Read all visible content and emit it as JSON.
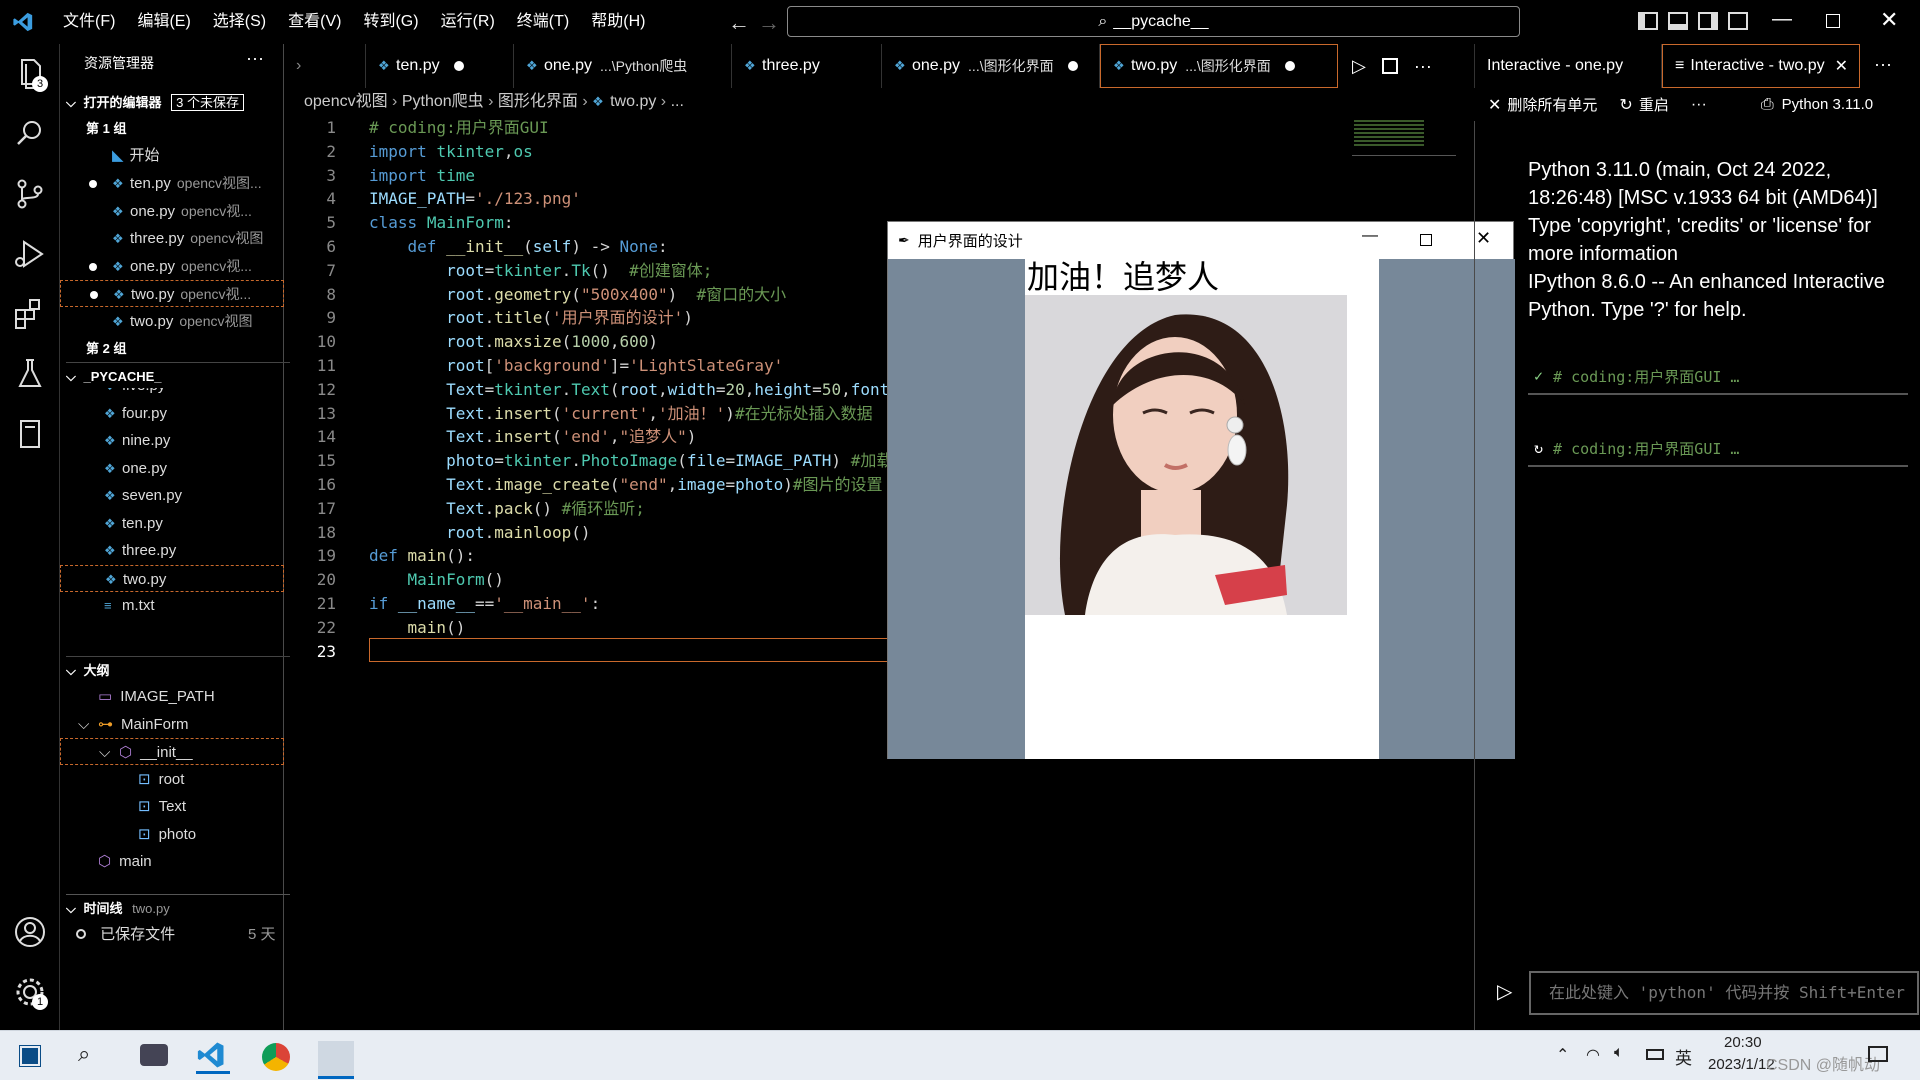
{
  "menu": [
    "文件(F)",
    "编辑(E)",
    "选择(S)",
    "查看(V)",
    "转到(G)",
    "运行(R)",
    "终端(T)",
    "帮助(H)"
  ],
  "search": {
    "text": "__pycache__"
  },
  "activity_badges": {
    "explorer": "3",
    "settings": "1"
  },
  "sidebar": {
    "title": "资源管理器",
    "open_editors": {
      "label": "打开的编辑器",
      "badge": "3 个未保存"
    },
    "group1": "第 1 组",
    "start": "开始",
    "files_group1": [
      {
        "name": "ten.py",
        "path": "opencv视图...",
        "dirty": true
      },
      {
        "name": "one.py",
        "path": "opencv视...",
        "dirty": false
      },
      {
        "name": "three.py",
        "path": "opencv视图",
        "dirty": false
      },
      {
        "name": "one.py",
        "path": "opencv视...",
        "dirty": true
      },
      {
        "name": "two.py",
        "path": "opencv视...",
        "dirty": true
      },
      {
        "name": "two.py",
        "path": "opencv视图",
        "dirty": false
      }
    ],
    "group2": "第 2 组",
    "pycache": "_PYCACHE_",
    "pycache_files": [
      "five.py",
      "four.py",
      "nine.py",
      "one.py",
      "seven.py",
      "ten.py",
      "three.py",
      "two.py",
      "m.txt"
    ],
    "outline": {
      "label": "大纲",
      "items": [
        {
          "name": "IMAGE_PATH",
          "depth": 0
        },
        {
          "name": "MainForm",
          "depth": 0
        },
        {
          "name": "__init__",
          "depth": 1
        },
        {
          "name": "root",
          "depth": 2
        },
        {
          "name": "Text",
          "depth": 2
        },
        {
          "name": "photo",
          "depth": 2
        },
        {
          "name": "main",
          "depth": 0
        }
      ]
    },
    "timeline": {
      "label": "时间线",
      "file": "two.py",
      "entry": "已保存文件",
      "age": "5 天"
    }
  },
  "tabs": [
    {
      "name": "ten.py",
      "desc": "",
      "dirty": true
    },
    {
      "name": "one.py",
      "desc": "...\\Python爬虫",
      "dirty": false
    },
    {
      "name": "three.py",
      "desc": "",
      "dirty": false
    },
    {
      "name": "one.py",
      "desc": "...\\图形化界面",
      "dirty": true
    },
    {
      "name": "two.py",
      "desc": "...\\图形化界面",
      "dirty": true,
      "active": true
    }
  ],
  "breadcrumb": [
    "opencv视图",
    "Python爬虫",
    "图形化界面",
    "two.py",
    "..."
  ],
  "code_lines": [
    "1",
    "2",
    "3",
    "4",
    "5",
    "6",
    "7",
    "8",
    "9",
    "10",
    "11",
    "12",
    "13",
    "14",
    "15",
    "16",
    "17",
    "18",
    "19",
    "20",
    "21",
    "22",
    "23"
  ],
  "tk_window": {
    "title": "用户界面的设计",
    "heading": "加油！追梦人"
  },
  "right_tabs": [
    "Interactive - one.py",
    "Interactive - two.py"
  ],
  "right_toolbar": {
    "clear": "删除所有单元",
    "restart": "重启",
    "kernel": "Python 3.11.0"
  },
  "interactive_output": {
    "banner": [
      "Python 3.11.0 (main, Oct 24 2022, 18:26:48) [MSC v.1933 64 bit (AMD64)]",
      "Type 'copyright', 'credits' or 'license' for more information",
      "IPython 8.6.0 -- An enhanced Interactive Python. Type '?' for help."
    ],
    "cells": [
      "# coding:用户界面GUI …",
      "# coding:用户界面GUI …"
    ]
  },
  "input_placeholder": "在此处键入 'python' 代码并按 Shift+Enter",
  "taskbar": {
    "time": "20:30",
    "date": "2023/1/12",
    "ime": "英",
    "watermark": "CSDN @随帆动"
  },
  "colors": {
    "accent_border": "#c9692c",
    "tk_background": "#778899",
    "python_icon": "#4fa5d6"
  }
}
